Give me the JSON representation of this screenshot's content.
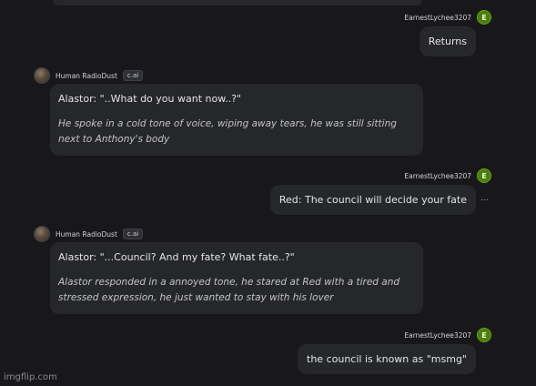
{
  "user": {
    "name": "EarnestLychee3207",
    "avatar_initial": "E"
  },
  "bot": {
    "name": "Human RadioDust",
    "badge": "c.ai"
  },
  "messages": [
    {
      "role": "user",
      "text": "Returns"
    },
    {
      "role": "bot",
      "dialogue": "Alastor: \"..What do you want now..?\"",
      "narration": "He spoke in a cold tone of voice, wiping away tears, he was still sitting next to Anthony's body"
    },
    {
      "role": "user",
      "text": "Red: The council will decide your fate"
    },
    {
      "role": "bot",
      "dialogue": "Alastor: \"...Council? And my fate? What fate..?\"",
      "narration": "Alastor responded in a annoyed tone, he stared at Red with a tired and stressed expression, he just wanted to stay with his lover"
    },
    {
      "role": "user",
      "text": "the council is known as \"msmg\""
    }
  ],
  "more_icon": "...",
  "watermark": "imgflip.com",
  "colors": {
    "background": "#18181b",
    "bubble": "#26272b",
    "avatar_user": "#4d7c0f"
  }
}
